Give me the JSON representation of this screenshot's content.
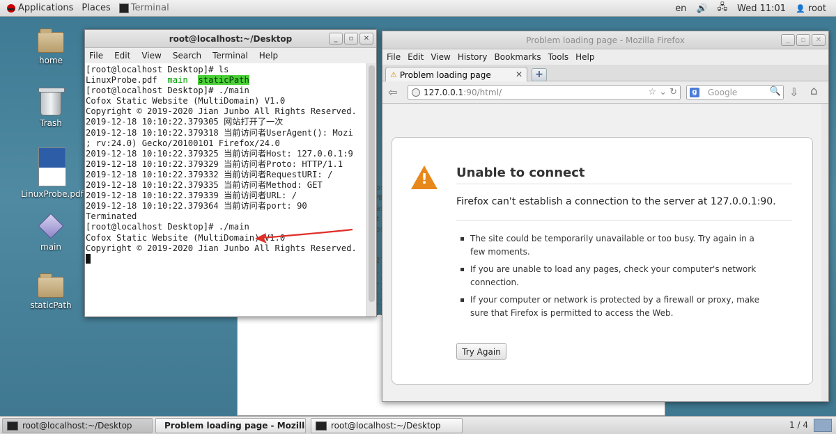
{
  "top_panel": {
    "applications": "Applications",
    "places": "Places",
    "terminal_task": "Terminal",
    "lang": "en",
    "clock": "Wed 11:01",
    "user": "root"
  },
  "desktop_icons": [
    {
      "label": "home",
      "icon": "home-folder-icon"
    },
    {
      "label": "Trash",
      "icon": "trash-icon"
    },
    {
      "label": "LinuxProbe.pdf",
      "icon": "pdf-file-icon"
    },
    {
      "label": "main",
      "icon": "executable-icon"
    },
    {
      "label": "staticPath",
      "icon": "folder-icon"
    }
  ],
  "terminal": {
    "title": "root@localhost:~/Desktop",
    "menu": [
      "File",
      "Edit",
      "View",
      "Search",
      "Terminal",
      "Help"
    ],
    "lines": {
      "l1": "[root@localhost Desktop]# ls",
      "l2a": "LinuxProbe.pdf  ",
      "l2b": "main",
      "l2c": "  ",
      "l2d": "staticPath",
      "l3": "[root@localhost Desktop]# ./main",
      "l4": "Cofox Static Website (MultiDomain) V1.0",
      "l5": "Copyright © 2019-2020 Jian Junbo All Rights Reserved.",
      "l6": "2019-12-18 10:10:22.379305 网站打开了一次",
      "l7": "2019-12-18 10:10:22.379318 当前访问者UserAgent(): Mozi",
      "l8": "; rv:24.0) Gecko/20100101 Firefox/24.0",
      "l9": "2019-12-18 10:10:22.379325 当前访问者Host: 127.0.0.1:9",
      "l10": "2019-12-18 10:10:22.379329 当前访问者Proto: HTTP/1.1",
      "l11": "2019-12-18 10:10:22.379332 当前访问者RequestURI: /",
      "l12": "2019-12-18 10:10:22.379335 当前访问者Method: GET",
      "l13": "2019-12-18 10:10:22.379339 当前访问者URL: /",
      "l14": "2019-12-18 10:10:22.379364 当前访问者port: 90",
      "l15": "Terminated",
      "l16": "[root@localhost Desktop]# ./main",
      "l17": "Cofox Static Website (MultiDomain) V1.0",
      "l18": "Copyright © 2019-2020 Jian Junbo All Rights Reserved."
    }
  },
  "firefox": {
    "title": "Problem loading page - Mozilla Firefox",
    "menu": [
      "File",
      "Edit",
      "View",
      "History",
      "Bookmarks",
      "Tools",
      "Help"
    ],
    "tab_label": "Problem loading page",
    "url_host": "127.0.0.1",
    "url_rest": ":90/html/",
    "search_placeholder": "Google",
    "error_title": "Unable to connect",
    "error_desc": "Firefox can't establish a connection to the server at 127.0.0.1:90.",
    "bullets": [
      "The site could be temporarily unavailable or too busy. Try again in a few moments.",
      "If you are unable to load any pages, check your computer's network connection.",
      "If your computer or network is protected by a firewall or proxy, make sure that Firefox is permitted to access the Web."
    ],
    "try_again": "Try Again"
  },
  "taskbar": {
    "items": [
      "root@localhost:~/Desktop",
      "Problem loading page - Mozilla ...",
      "root@localhost:~/Desktop"
    ],
    "workspace": "1 / 4"
  },
  "colors": {
    "desktop": "#3f7a94",
    "warning": "#e8881a",
    "annotation_arrow": "#e0302a",
    "ls_highlight": "#4cd038"
  }
}
